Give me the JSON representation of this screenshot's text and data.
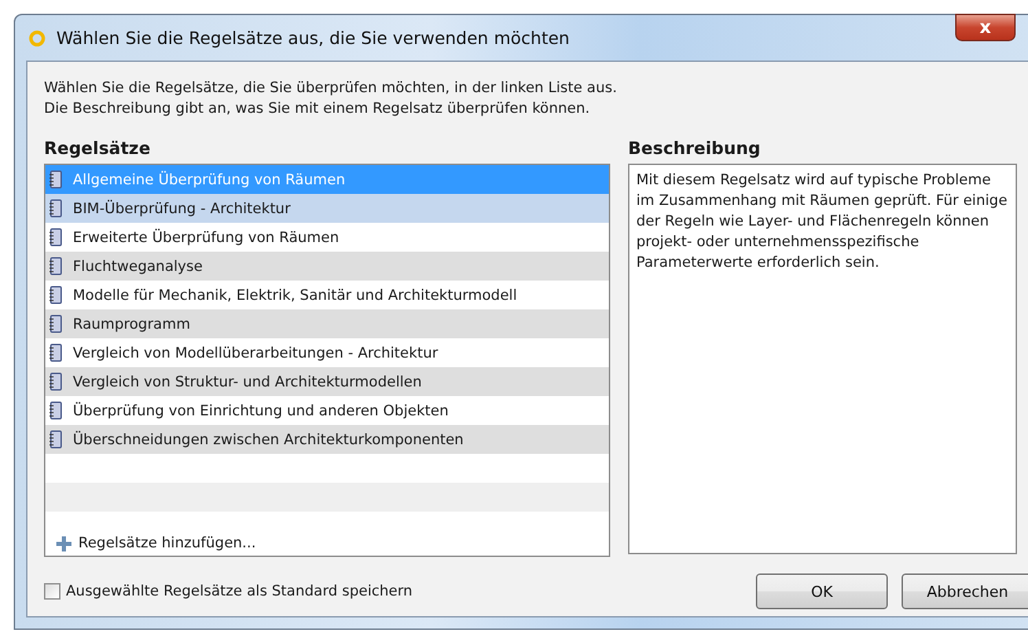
{
  "window": {
    "title": "Wählen Sie die Regelsätze aus, die Sie verwenden möchten",
    "close": "x"
  },
  "intro": [
    "Wählen Sie die Regelsätze, die Sie überprüfen möchten, in der linken Liste aus.",
    "Die Beschreibung gibt an, was Sie mit einem Regelsatz überprüfen können."
  ],
  "rulesets": {
    "heading": "Regelsätze",
    "items": [
      {
        "label": "Allgemeine Überprüfung von Räumen",
        "selected": true,
        "hovered": false
      },
      {
        "label": "BIM-Überprüfung - Architektur",
        "selected": false,
        "hovered": true
      },
      {
        "label": "Erweiterte Überprüfung von Räumen",
        "selected": false,
        "hovered": false
      },
      {
        "label": "Fluchtweganalyse",
        "selected": false,
        "hovered": false
      },
      {
        "label": "Modelle für Mechanik, Elektrik, Sanitär und Architekturmodell",
        "selected": false,
        "hovered": false
      },
      {
        "label": "Raumprogramm",
        "selected": false,
        "hovered": false
      },
      {
        "label": "Vergleich von Modellüberarbeitungen - Architektur",
        "selected": false,
        "hovered": false
      },
      {
        "label": "Vergleich von Struktur- und Architekturmodellen",
        "selected": false,
        "hovered": false
      },
      {
        "label": "Überprüfung von Einrichtung und anderen Objekten",
        "selected": false,
        "hovered": false
      },
      {
        "label": "Überschneidungen zwischen Architekturkomponenten",
        "selected": false,
        "hovered": false
      }
    ],
    "add_link": "Regelsätze hinzufügen..."
  },
  "description": {
    "heading": "Beschreibung",
    "text": "Mit diesem Regelsatz wird auf typische Probleme im Zusammenhang mit Räumen geprüft. Für einige der Regeln wie Layer- und Flächenregeln können projekt- oder unternehmensspezifische Parameterwerte erforderlich sein."
  },
  "save_default": {
    "label": "Ausgewählte Regelsätze als Standard speichern",
    "checked": false
  },
  "buttons": [
    "OK",
    "Abbrechen"
  ]
}
